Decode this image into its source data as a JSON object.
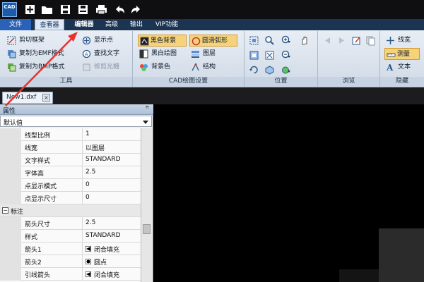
{
  "titlebar": {
    "logo": "CAD",
    "quick_access": [
      {
        "icon": "new-file-icon"
      },
      {
        "icon": "open-folder-icon"
      },
      {
        "icon": "save-icon"
      },
      {
        "icon": "save-as-icon"
      },
      {
        "icon": "print-icon"
      },
      {
        "icon": "undo-icon"
      },
      {
        "icon": "redo-icon"
      }
    ]
  },
  "menu": {
    "file": "文件",
    "viewer": "查看器",
    "editor": "编辑器",
    "advanced": "高级",
    "output": "输出",
    "vip": "VIP功能"
  },
  "ribbon": {
    "tools": {
      "label": "工具",
      "clip_frame": "剪切框架",
      "copy_emf": "复制为EMF格式",
      "copy_bmp": "复制为BMP格式",
      "show_points": "显示点",
      "find_text": "查找文字",
      "trim_raster": "修剪光栅"
    },
    "cad_settings": {
      "label": "CAD绘图设置",
      "black_bg": "黑色背景",
      "smooth_arc": "圆滑弧形",
      "bw_drawing": "黑白绘图",
      "layers": "图层",
      "bg_color": "背景色",
      "structure": "结构"
    },
    "position": {
      "label": "位置"
    },
    "browse": {
      "label": "浏览"
    },
    "hide": {
      "label": "隐藏",
      "line_width": "线宽",
      "measure": "测量",
      "text": "文本"
    }
  },
  "document_tab": {
    "name": "New1.dxf",
    "close": "×"
  },
  "properties": {
    "title": "属性",
    "pin": "ꟸ",
    "combo_value": "默认值",
    "rows": [
      {
        "name": "线型比例",
        "value": "1"
      },
      {
        "name": "线宽",
        "value": "以图层"
      },
      {
        "name": "文字样式",
        "value": "STANDARD"
      },
      {
        "name": "字体高",
        "value": "2.5"
      },
      {
        "name": "点显示模式",
        "value": "0"
      },
      {
        "name": "点显示尺寸",
        "value": "0"
      }
    ],
    "category": {
      "expander": "−",
      "label": "标注"
    },
    "dim_rows": [
      {
        "name": "箭头尺寸",
        "value": "2.5"
      },
      {
        "name": "样式",
        "value": "STANDARD"
      },
      {
        "name": "箭头1",
        "value": "闭合填充",
        "icon": "arrow-filled-icon"
      },
      {
        "name": "箭头2",
        "value": "圆点",
        "icon": "dot-icon"
      },
      {
        "name": "引线箭头",
        "value": "闭合填充",
        "icon": "arrow-filled-icon"
      }
    ]
  },
  "colors": {
    "annotation_arrow": "#e8322c",
    "selected_button": "#f6d37a",
    "menu_active": "#2a62b8"
  }
}
